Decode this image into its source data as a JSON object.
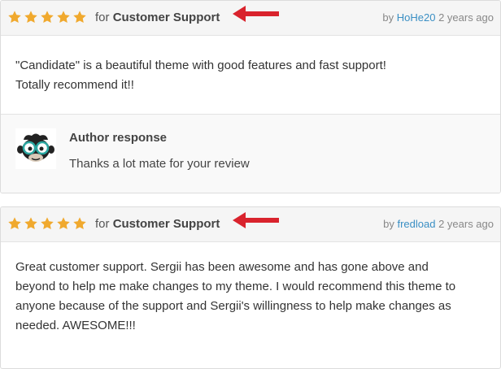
{
  "reviews": [
    {
      "rating": 5,
      "for_prefix": "for",
      "category": "Customer Support",
      "by_prefix": "by",
      "user": "HoHe20",
      "time": "2 years ago",
      "body_lines": [
        "\"Candidate\" is a beautiful theme with good features and fast support!",
        "Totally recommend it!!"
      ],
      "response": {
        "title": "Author response",
        "text": "Thanks a lot mate for your review"
      }
    },
    {
      "rating": 5,
      "for_prefix": "for",
      "category": "Customer Support",
      "by_prefix": "by",
      "user": "fredload",
      "time": "2 years ago",
      "body_lines": [
        "Great customer support. Sergii has been awesome and has gone above and",
        "beyond to help me make changes to my theme. I would recommend this theme to",
        "anyone because of the support and Sergii's willingness to help make changes as",
        "needed. AWESOME!!!"
      ]
    }
  ],
  "colors": {
    "star": "#f0a92e",
    "arrow": "#d9232d",
    "link": "#3a8fc4"
  }
}
